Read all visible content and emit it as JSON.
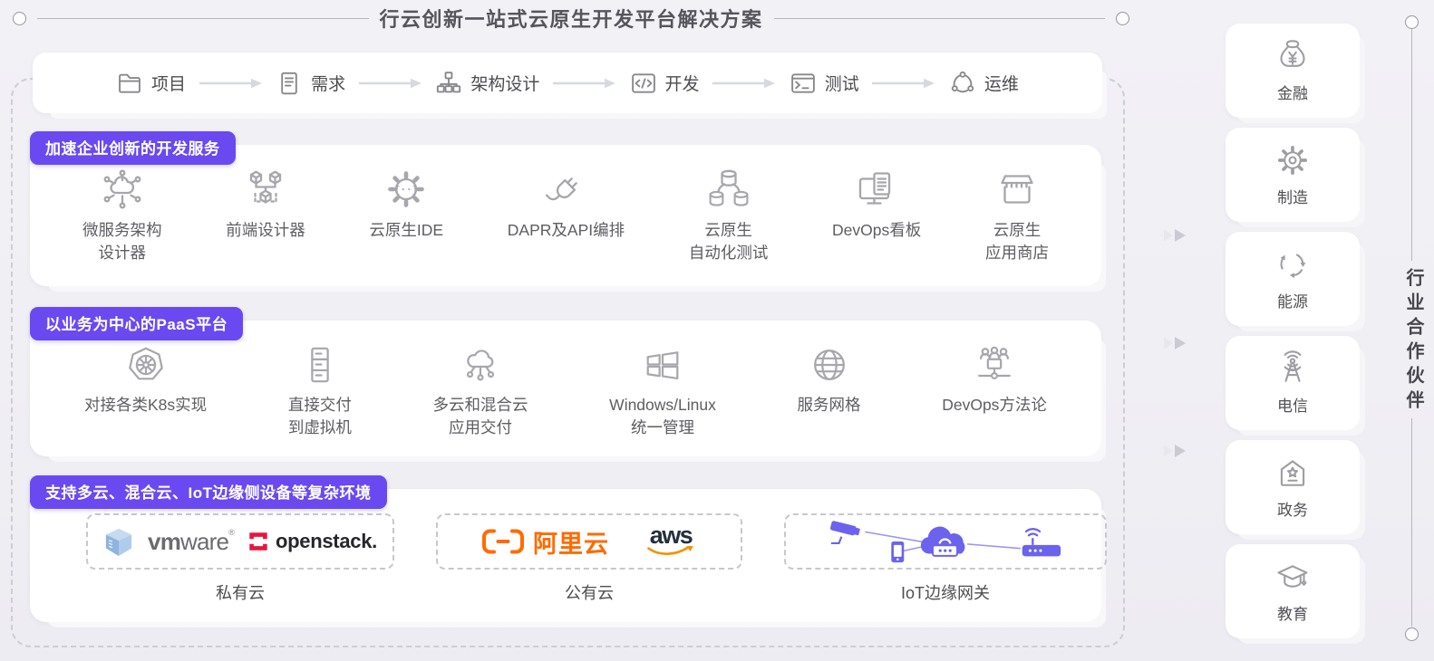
{
  "title": "行云创新一站式云原生开发平台解决方案",
  "pipeline": {
    "steps": [
      "项目",
      "需求",
      "架构设计",
      "开发",
      "测试",
      "运维"
    ]
  },
  "dev_services": {
    "badge": "加速企业创新的开发服务",
    "items": [
      {
        "line1": "微服务架构",
        "line2": "设计器"
      },
      {
        "line1": "前端设计器",
        "line2": ""
      },
      {
        "line1": "云原生IDE",
        "line2": ""
      },
      {
        "line1": "DAPR及API编排",
        "line2": ""
      },
      {
        "line1": "云原生",
        "line2": "自动化测试"
      },
      {
        "line1": "DevOps看板",
        "line2": ""
      },
      {
        "line1": "云原生",
        "line2": "应用商店"
      }
    ]
  },
  "paas": {
    "badge": "以业务为中心的PaaS平台",
    "items": [
      {
        "line1": "对接各类K8s实现",
        "line2": ""
      },
      {
        "line1": "直接交付",
        "line2": "到虚拟机"
      },
      {
        "line1": "多云和混合云",
        "line2": "应用交付"
      },
      {
        "line1": "Windows/Linux",
        "line2": "统一管理"
      },
      {
        "line1": "服务网格",
        "line2": ""
      },
      {
        "line1": "DevOps方法论",
        "line2": ""
      }
    ]
  },
  "environments": {
    "badge": "支持多云、混合云、IoT边缘侧设备等复杂环境",
    "groups": [
      {
        "label": "私有云"
      },
      {
        "label": "公有云"
      },
      {
        "label": "IoT边缘网关"
      }
    ],
    "logos": {
      "vmware_bold": "vm",
      "vmware_rest": "ware",
      "vmware_reg": "®",
      "openstack": "openstack.",
      "aliyun": "阿里云",
      "aws": "aws"
    }
  },
  "industries": {
    "side_label": "行业合作伙伴",
    "items": [
      {
        "label": "金融",
        "icon": "money-bag-icon"
      },
      {
        "label": "制造",
        "icon": "gear-icon"
      },
      {
        "label": "能源",
        "icon": "recycle-icon"
      },
      {
        "label": "电信",
        "icon": "antenna-tower-icon"
      },
      {
        "label": "政务",
        "icon": "government-building-icon"
      },
      {
        "label": "教育",
        "icon": "graduation-cap-icon"
      }
    ]
  },
  "colors": {
    "accent_purple": "#6a4af0",
    "iot_purple": "#6b63ee",
    "openstack_red": "#e8153d",
    "aliyun_orange": "#ff6a00",
    "aws_navy": "#252f3e",
    "aws_orange": "#f59100"
  }
}
